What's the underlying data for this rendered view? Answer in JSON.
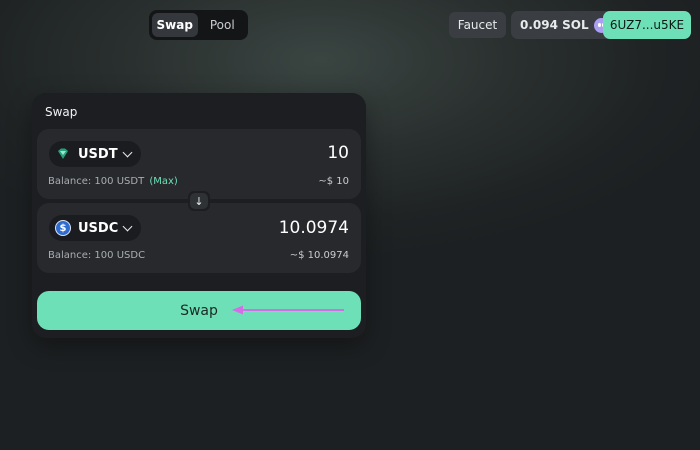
{
  "nav": {
    "tabs": [
      {
        "label": "Swap",
        "active": true
      },
      {
        "label": "Pool",
        "active": false
      }
    ]
  },
  "header": {
    "faucet_label": "Faucet",
    "sol_balance": "0.094 SOL",
    "wallet_icon": "phantom-icon",
    "address": "6UZ7...u5KE"
  },
  "swap": {
    "title": "Swap",
    "from": {
      "token": "USDT",
      "amount": "10",
      "balance_text": "Balance: 100 USDT",
      "max_label": "(Max)",
      "usd_value": "~$ 10"
    },
    "to": {
      "token": "USDC",
      "icon_glyph": "$",
      "amount": "10.0974",
      "balance_text": "Balance: 100 USDC",
      "usd_value": "~$ 10.0974"
    },
    "switch_glyph": "↓",
    "button_label": "Swap"
  },
  "colors": {
    "accent": "#6ee0b8",
    "annotation_arrow": "#d36ee6"
  }
}
